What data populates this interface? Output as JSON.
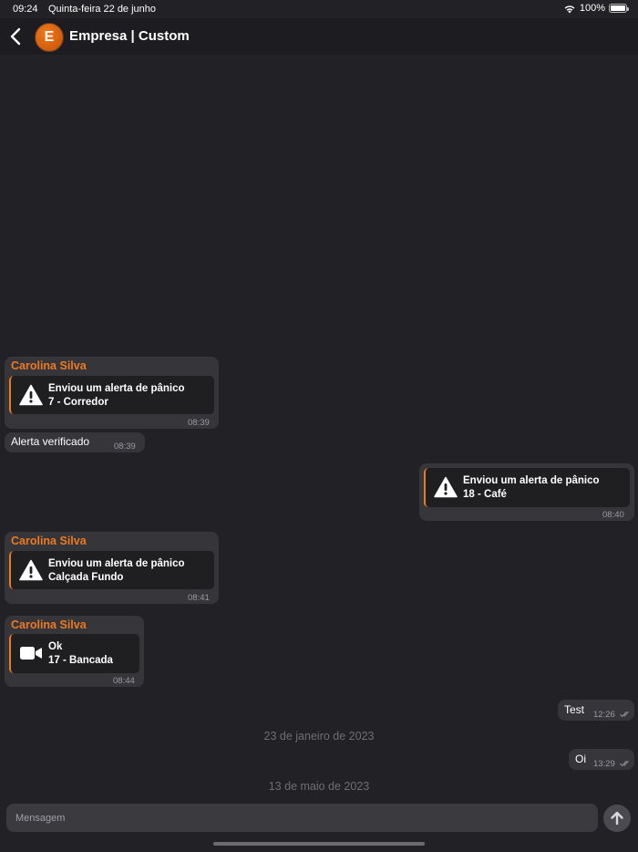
{
  "status_bar": {
    "time": "09:24",
    "date": "Quinta-feira 22 de junho",
    "battery": "100%",
    "battery_level": 1.0
  },
  "header": {
    "avatar_letter": "E",
    "title": "Empresa | Custom"
  },
  "colors": {
    "accent": "#ec7a22",
    "background": "#222226",
    "bubble": "#35353a"
  },
  "messages": [
    {
      "sender": "Carolina Silva",
      "icon": "warning-icon",
      "line1": "Enviou um alerta de pânico",
      "line2": "7 - Corredor",
      "time": "08:39"
    },
    {
      "text": "Alerta verificado",
      "time": "08:39"
    },
    {
      "icon": "warning-icon",
      "line1": "Enviou um alerta de pânico",
      "line2": "18 - Café",
      "time": "08:40"
    },
    {
      "sender": "Carolina Silva",
      "icon": "warning-icon",
      "line1": "Enviou um alerta de pânico",
      "line2": "Calçada Fundo",
      "time": "08:41"
    },
    {
      "sender": "Carolina Silva",
      "icon": "video-camera-icon",
      "line1": "Ok",
      "line2": "17 - Bancada",
      "time": "08:44"
    },
    {
      "text": "Test",
      "time": "12:26"
    },
    {
      "text": "Oi",
      "time": "13:29"
    }
  ],
  "date_separators": [
    "23 de janeiro de 2023",
    "13 de maio de 2023"
  ],
  "composer": {
    "placeholder": "Mensagem"
  }
}
